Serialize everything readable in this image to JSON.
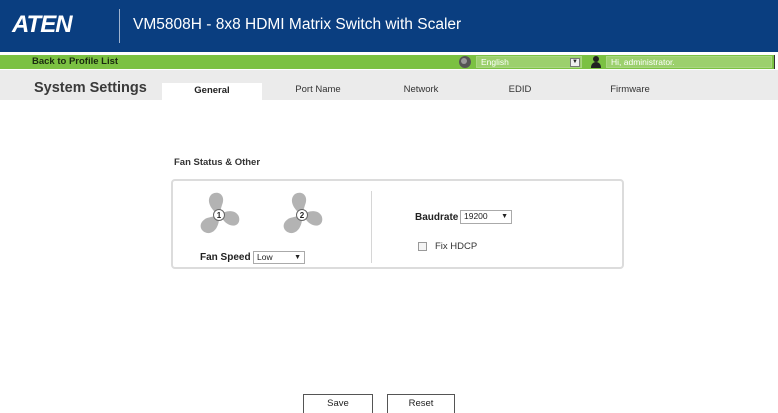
{
  "header": {
    "logo_text": "ATEN",
    "title": "VM5808H - 8x8 HDMI Matrix Switch with Scaler"
  },
  "topbar": {
    "back_link": "Back to Profile List",
    "language": "English",
    "user": "Hi, administrator."
  },
  "page": {
    "section_title": "System Settings",
    "tabs": [
      {
        "label": "General",
        "active": true
      },
      {
        "label": "Port Name",
        "active": false
      },
      {
        "label": "Network",
        "active": false
      },
      {
        "label": "EDID",
        "active": false
      },
      {
        "label": "Firmware",
        "active": false
      }
    ]
  },
  "fan_section": {
    "title": "Fan Status & Other",
    "fans": [
      {
        "number": "1",
        "icon": "fan-icon"
      },
      {
        "number": "2",
        "icon": "fan-icon"
      }
    ],
    "fan_speed_label": "Fan Speed",
    "fan_speed_value": "Low",
    "baudrate_label": "Baudrate",
    "baudrate_value": "19200",
    "fix_hdcp_label": "Fix HDCP",
    "fix_hdcp_checked": false
  },
  "actions": {
    "save_label": "Save",
    "reset_label": "Reset"
  },
  "colors": {
    "header_bg": "#0a3e80",
    "green_bar": "#7bc142",
    "tab_bar": "#ebebeb",
    "fan_gray": "#b3b3b3"
  }
}
